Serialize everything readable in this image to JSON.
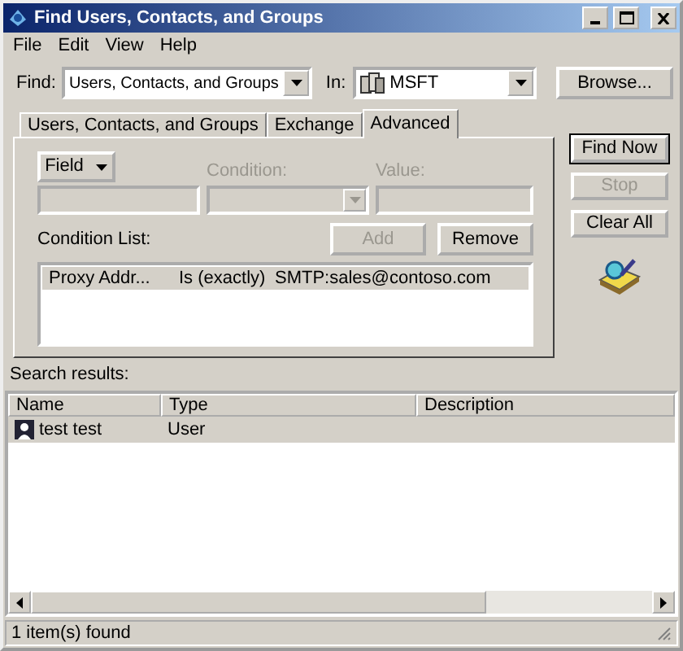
{
  "window": {
    "title": "Find Users, Contacts, and Groups"
  },
  "menu": [
    "File",
    "Edit",
    "View",
    "Help"
  ],
  "find": {
    "label": "Find:",
    "value": "Users, Contacts, and Groups"
  },
  "scope": {
    "label": "In:",
    "value": "MSFT"
  },
  "browse_button": "Browse...",
  "tabs": [
    {
      "label": "Users, Contacts, and Groups",
      "selected": false
    },
    {
      "label": "Exchange",
      "selected": false
    },
    {
      "label": "Advanced",
      "selected": true
    }
  ],
  "advanced": {
    "field_button": "Field",
    "condition_label": {
      "text": "Condition:",
      "disabled": true
    },
    "value_label": {
      "text": "Value:",
      "disabled": true
    },
    "condition_list_label": "Condition List:",
    "add_button": {
      "label": "Add",
      "disabled": true
    },
    "remove_button": {
      "label": "Remove",
      "disabled": false
    },
    "conditions": [
      {
        "field": "Proxy Addr...",
        "condition": "Is (exactly)",
        "value": "SMTP:sales@contoso.com",
        "selected": true
      }
    ]
  },
  "actions": [
    {
      "label": "Find Now",
      "disabled": false,
      "default": true
    },
    {
      "label": "Stop",
      "disabled": true,
      "default": false
    },
    {
      "label": "Clear All",
      "disabled": false,
      "default": false
    }
  ],
  "results_label": "Search results:",
  "results": {
    "columns": [
      "Name",
      "Type",
      "Description"
    ],
    "rows": [
      {
        "name": "test test",
        "type": "User",
        "selected": true
      }
    ]
  },
  "status_bar": "1 item(s) found"
}
